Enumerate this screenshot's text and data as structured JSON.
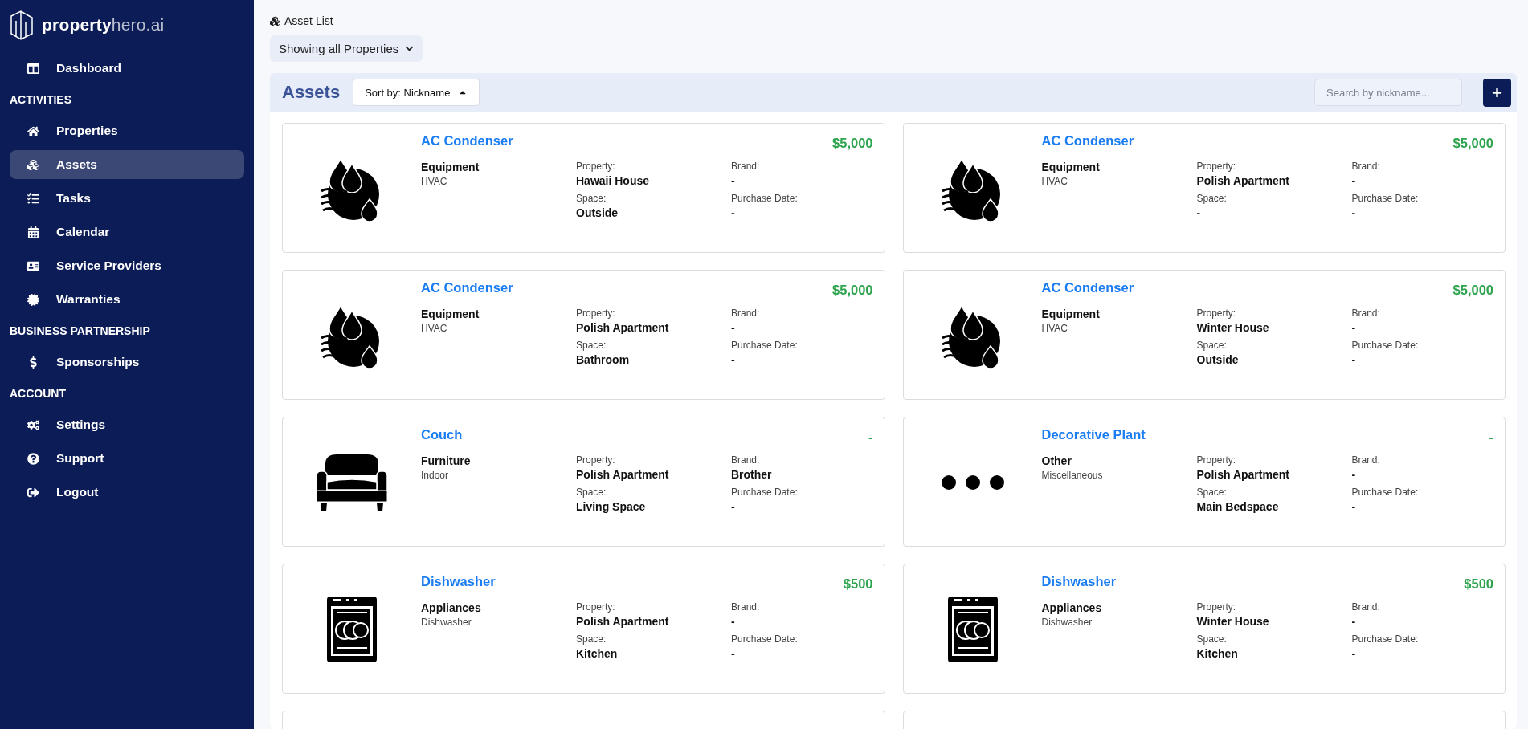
{
  "brand": {
    "name": "property",
    "suffix": "hero.ai"
  },
  "sidebar": {
    "sections": [
      {
        "items": [
          {
            "label": "Dashboard",
            "selected": false
          }
        ]
      },
      {
        "heading": "ACTIVITIES",
        "items": [
          {
            "label": "Properties",
            "selected": false
          },
          {
            "label": "Assets",
            "selected": true
          },
          {
            "label": "Tasks",
            "selected": false
          },
          {
            "label": "Calendar",
            "selected": false
          },
          {
            "label": "Service Providers",
            "selected": false
          },
          {
            "label": "Warranties",
            "selected": false
          }
        ]
      },
      {
        "heading": "BUSINESS PARTNERSHIP",
        "items": [
          {
            "label": "Sponsorships",
            "selected": false
          }
        ]
      },
      {
        "heading": "ACCOUNT",
        "items": [
          {
            "label": "Settings",
            "selected": false
          },
          {
            "label": "Support",
            "selected": false
          },
          {
            "label": "Logout",
            "selected": false
          }
        ]
      }
    ]
  },
  "breadcrumb": "Asset List",
  "filter": "Showing all Properties",
  "panel": {
    "title": "Assets",
    "sort": "Sort by: Nickname",
    "search": {
      "placeholder": "Search by nickname..."
    }
  },
  "assets": [
    {
      "kind": "hvac",
      "name": "AC Condenser",
      "price": "$5,000",
      "category": "Equipment",
      "subcategory": "HVAC",
      "fields": [
        {
          "label": "Property:",
          "value": "Hawaii House"
        },
        {
          "label": "Brand:",
          "value": "-"
        },
        {
          "label": "Space:",
          "value": "Outside"
        },
        {
          "label": "Purchase Date:",
          "value": "-"
        }
      ]
    },
    {
      "kind": "hvac",
      "name": "AC Condenser",
      "price": "$5,000",
      "category": "Equipment",
      "subcategory": "HVAC",
      "fields": [
        {
          "label": "Property:",
          "value": "Polish Apartment"
        },
        {
          "label": "Brand:",
          "value": "-"
        },
        {
          "label": "Space:",
          "value": "-"
        },
        {
          "label": "Purchase Date:",
          "value": "-"
        }
      ]
    },
    {
      "kind": "hvac",
      "name": "AC Condenser",
      "price": "$5,000",
      "category": "Equipment",
      "subcategory": "HVAC",
      "fields": [
        {
          "label": "Property:",
          "value": "Polish Apartment"
        },
        {
          "label": "Brand:",
          "value": "-"
        },
        {
          "label": "Space:",
          "value": "Bathroom"
        },
        {
          "label": "Purchase Date:",
          "value": "-"
        }
      ]
    },
    {
      "kind": "hvac",
      "name": "AC Condenser",
      "price": "$5,000",
      "category": "Equipment",
      "subcategory": "HVAC",
      "fields": [
        {
          "label": "Property:",
          "value": "Winter House"
        },
        {
          "label": "Brand:",
          "value": "-"
        },
        {
          "label": "Space:",
          "value": "Outside"
        },
        {
          "label": "Purchase Date:",
          "value": "-"
        }
      ]
    },
    {
      "kind": "couch",
      "name": "Couch",
      "price": "-",
      "category": "Furniture",
      "subcategory": "Indoor",
      "fields": [
        {
          "label": "Property:",
          "value": "Polish Apartment"
        },
        {
          "label": "Brand:",
          "value": "Brother"
        },
        {
          "label": "Space:",
          "value": "Living Space"
        },
        {
          "label": "Purchase Date:",
          "value": "-"
        }
      ]
    },
    {
      "kind": "dots",
      "name": "Decorative Plant",
      "price": "-",
      "category": "Other",
      "subcategory": "Miscellaneous",
      "fields": [
        {
          "label": "Property:",
          "value": "Polish Apartment"
        },
        {
          "label": "Brand:",
          "value": "-"
        },
        {
          "label": "Space:",
          "value": "Main Bedspace"
        },
        {
          "label": "Purchase Date:",
          "value": "-"
        }
      ]
    },
    {
      "kind": "dishwasher",
      "name": "Dishwasher",
      "price": "$500",
      "category": "Appliances",
      "subcategory": "Dishwasher",
      "fields": [
        {
          "label": "Property:",
          "value": "Polish Apartment"
        },
        {
          "label": "Brand:",
          "value": "-"
        },
        {
          "label": "Space:",
          "value": "Kitchen"
        },
        {
          "label": "Purchase Date:",
          "value": "-"
        }
      ]
    },
    {
      "kind": "dishwasher",
      "name": "Dishwasher",
      "price": "$500",
      "category": "Appliances",
      "subcategory": "Dishwasher",
      "fields": [
        {
          "label": "Property:",
          "value": "Winter House"
        },
        {
          "label": "Brand:",
          "value": "-"
        },
        {
          "label": "Space:",
          "value": "Kitchen"
        },
        {
          "label": "Purchase Date:",
          "value": "-"
        }
      ]
    },
    {
      "kind": "blank"
    },
    {
      "kind": "blank"
    }
  ]
}
